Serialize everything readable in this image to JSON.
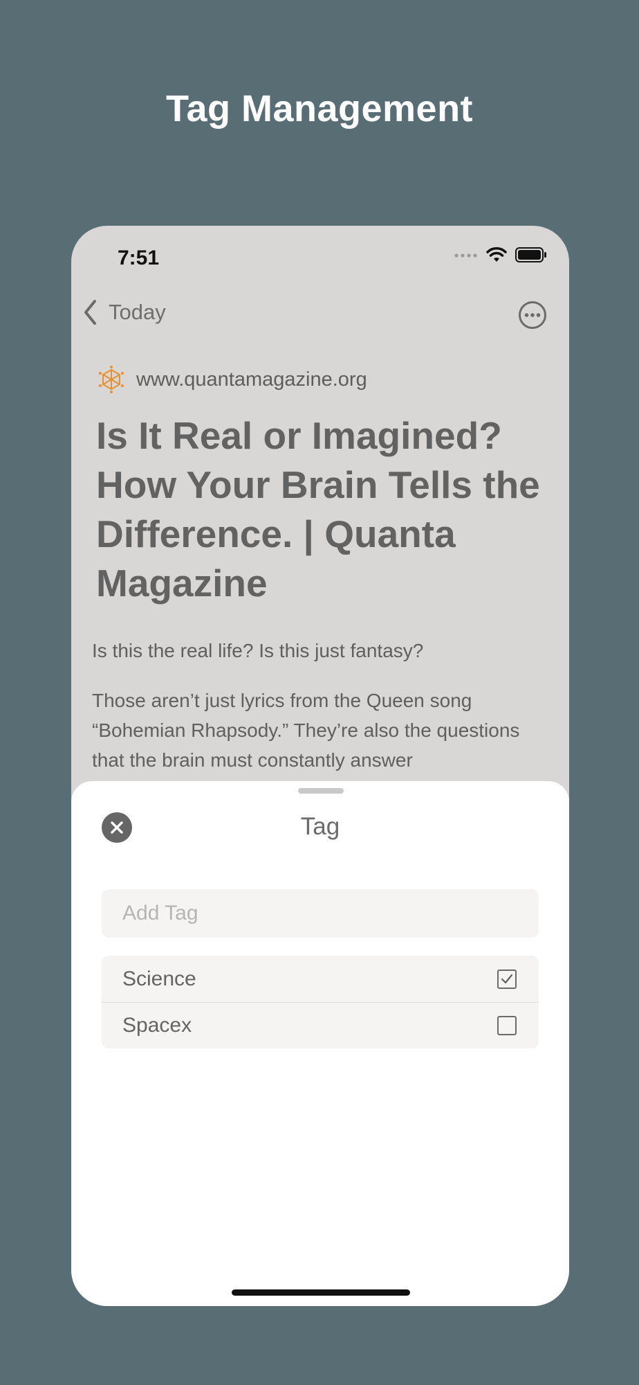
{
  "page": {
    "title": "Tag Management"
  },
  "status_bar": {
    "time": "7:51",
    "icons": [
      "cellular-signal-icon",
      "wifi-icon",
      "battery-icon"
    ]
  },
  "nav": {
    "back_label": "Today",
    "back_icon": "chevron-left-icon",
    "more_icon": "ellipsis-circle-icon"
  },
  "article": {
    "source_icon": "quanta-logo-icon",
    "source": "www.quantamagazine.org",
    "title": "Is It Real or Imagined? How Your Brain Tells the Difference. | Quanta Magazine",
    "paragraphs": [
      "Is this the real life? Is this just fantasy?",
      "Those aren’t just lyrics from the Queen song “Bohemian Rhapsody.” They’re also the questions that the brain must constantly answer"
    ]
  },
  "sheet": {
    "title": "Tag",
    "close_icon": "close-icon",
    "add_tag_placeholder": "Add Tag",
    "add_tag_value": "",
    "tags": [
      {
        "label": "Science",
        "checked": true
      },
      {
        "label": "Spacex",
        "checked": false
      }
    ]
  },
  "colors": {
    "background": "#586d74",
    "phone_dimmed": "#d8d7d5",
    "sheet": "#ffffff",
    "field": "#f5f4f2",
    "source_icon": "#e8902e"
  }
}
